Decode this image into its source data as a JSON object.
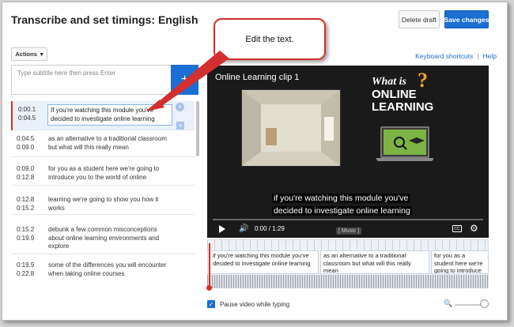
{
  "header": {
    "title": "Transcribe and set timings: English",
    "delete_label": "Delete draft",
    "save_label": "Save changes"
  },
  "toolbar": {
    "actions_label": "Actions",
    "keyboard_shortcuts": "Keyboard shortcuts",
    "separator": "|",
    "help": "Help"
  },
  "editor": {
    "placeholder": "Type subtitle here then press Enter",
    "add_icon": "plus-icon"
  },
  "subtitles": [
    {
      "start": "0:00.1",
      "end": "0:04.5",
      "text": "If you're watching this module you've decided to investigate online learning",
      "active": true
    },
    {
      "start": "0:04.5",
      "end": "0:09.0",
      "text": "as an alternative to a traditional classroom but what will this really mean"
    },
    {
      "start": "0:09.0",
      "end": "0:12.8",
      "text": "for you as a student here we're going to introduce you to the world of online"
    },
    {
      "start": "0:12.8",
      "end": "0:15.2",
      "text": "learning we're going to show you how it works"
    },
    {
      "start": "0:15.2",
      "end": "0:19.9",
      "text": "debunk a few common misconceptions about online learning environments and explore"
    },
    {
      "start": "0:19.9",
      "end": "0:22.8",
      "text": "some of the differences you will encounter when taking online courses"
    }
  ],
  "video": {
    "clip_title": "Online Learning clip 1",
    "logo_what": "What is",
    "logo_q": "?",
    "logo_online": "ONLINE",
    "logo_learning": "LEARNING",
    "caption_line1": "if you're watching this module you've",
    "caption_line2": "decided to investigate online learning",
    "time": "0:00 / 1:29",
    "music_tag": "[ Music ]",
    "cc_label": "CC",
    "progress": 0.0
  },
  "timeline": {
    "segments": [
      "if you're watching this module you've decided to investigate online learning",
      "as an alternative to a traditional classroom but what will this really mean",
      "for you as a student here we're going to introduce you to the world"
    ]
  },
  "footer": {
    "pause_label": "Pause video while typing",
    "pause_checked": true
  },
  "callout": {
    "text": "Edit the text."
  },
  "colors": {
    "accent": "#1b6ed2",
    "callout_border": "#d32f2f",
    "playhead": "#d93025"
  }
}
